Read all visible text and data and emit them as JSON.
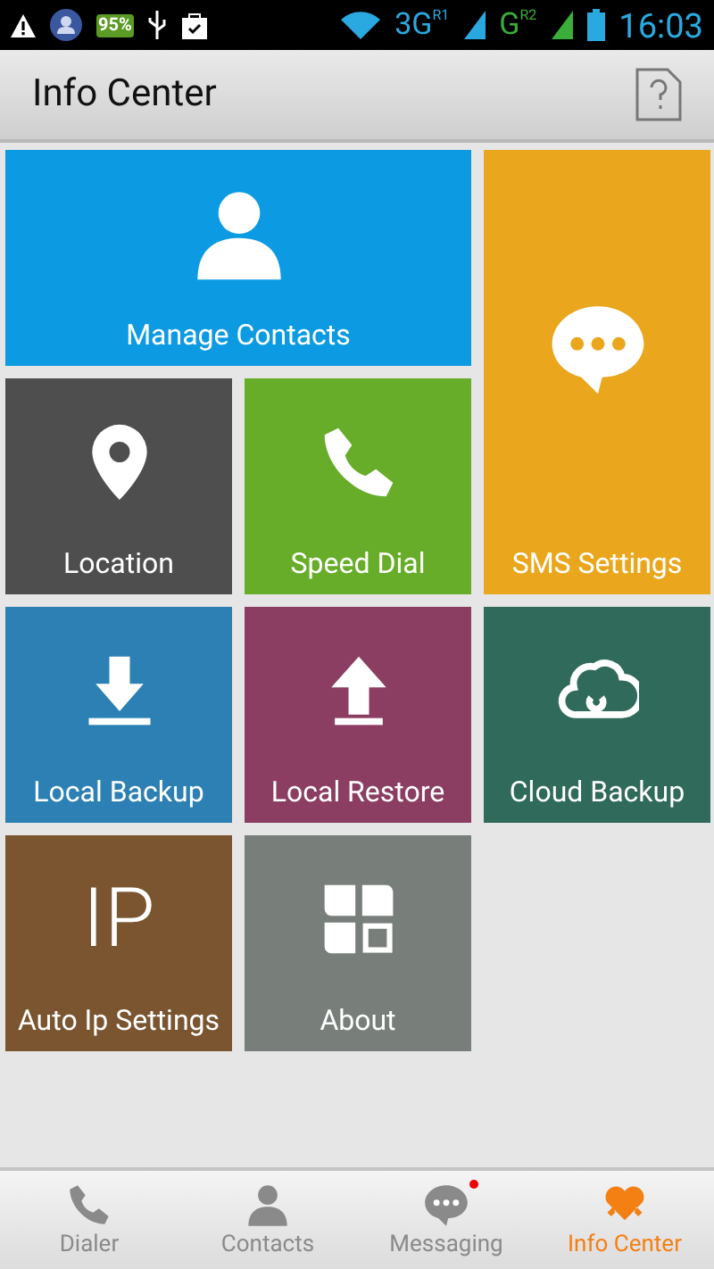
{
  "status_bar": {
    "battery_badge": "95%",
    "network_1": "3G",
    "network_1_sup": "R",
    "signal_1_index": "1",
    "network_2": "G",
    "network_2_sup": "R",
    "signal_2_index": "2",
    "time": "16:03"
  },
  "title_bar": {
    "title": "Info Center"
  },
  "tiles": [
    {
      "label": "Manage Contacts",
      "color": "#0c9be3"
    },
    {
      "label": "Location",
      "color": "#4e4e4e"
    },
    {
      "label": "Speed Dial",
      "color": "#67ad2a"
    },
    {
      "label": "SMS Settings",
      "color": "#eaa71e"
    },
    {
      "label": "Local Backup",
      "color": "#2c80b4"
    },
    {
      "label": "Local Restore",
      "color": "#8b3e62"
    },
    {
      "label": "Cloud Backup",
      "color": "#2f6a5a"
    },
    {
      "label": "Auto Ip Settings",
      "icon_text": "IP",
      "color": "#7a5530"
    },
    {
      "label": "About",
      "color": "#787f7b"
    }
  ],
  "bottom_nav": [
    {
      "label": "Dialer",
      "selected": false,
      "badge": false
    },
    {
      "label": "Contacts",
      "selected": false,
      "badge": false
    },
    {
      "label": "Messaging",
      "selected": false,
      "badge": true
    },
    {
      "label": "Info Center",
      "selected": true,
      "badge": false
    }
  ]
}
